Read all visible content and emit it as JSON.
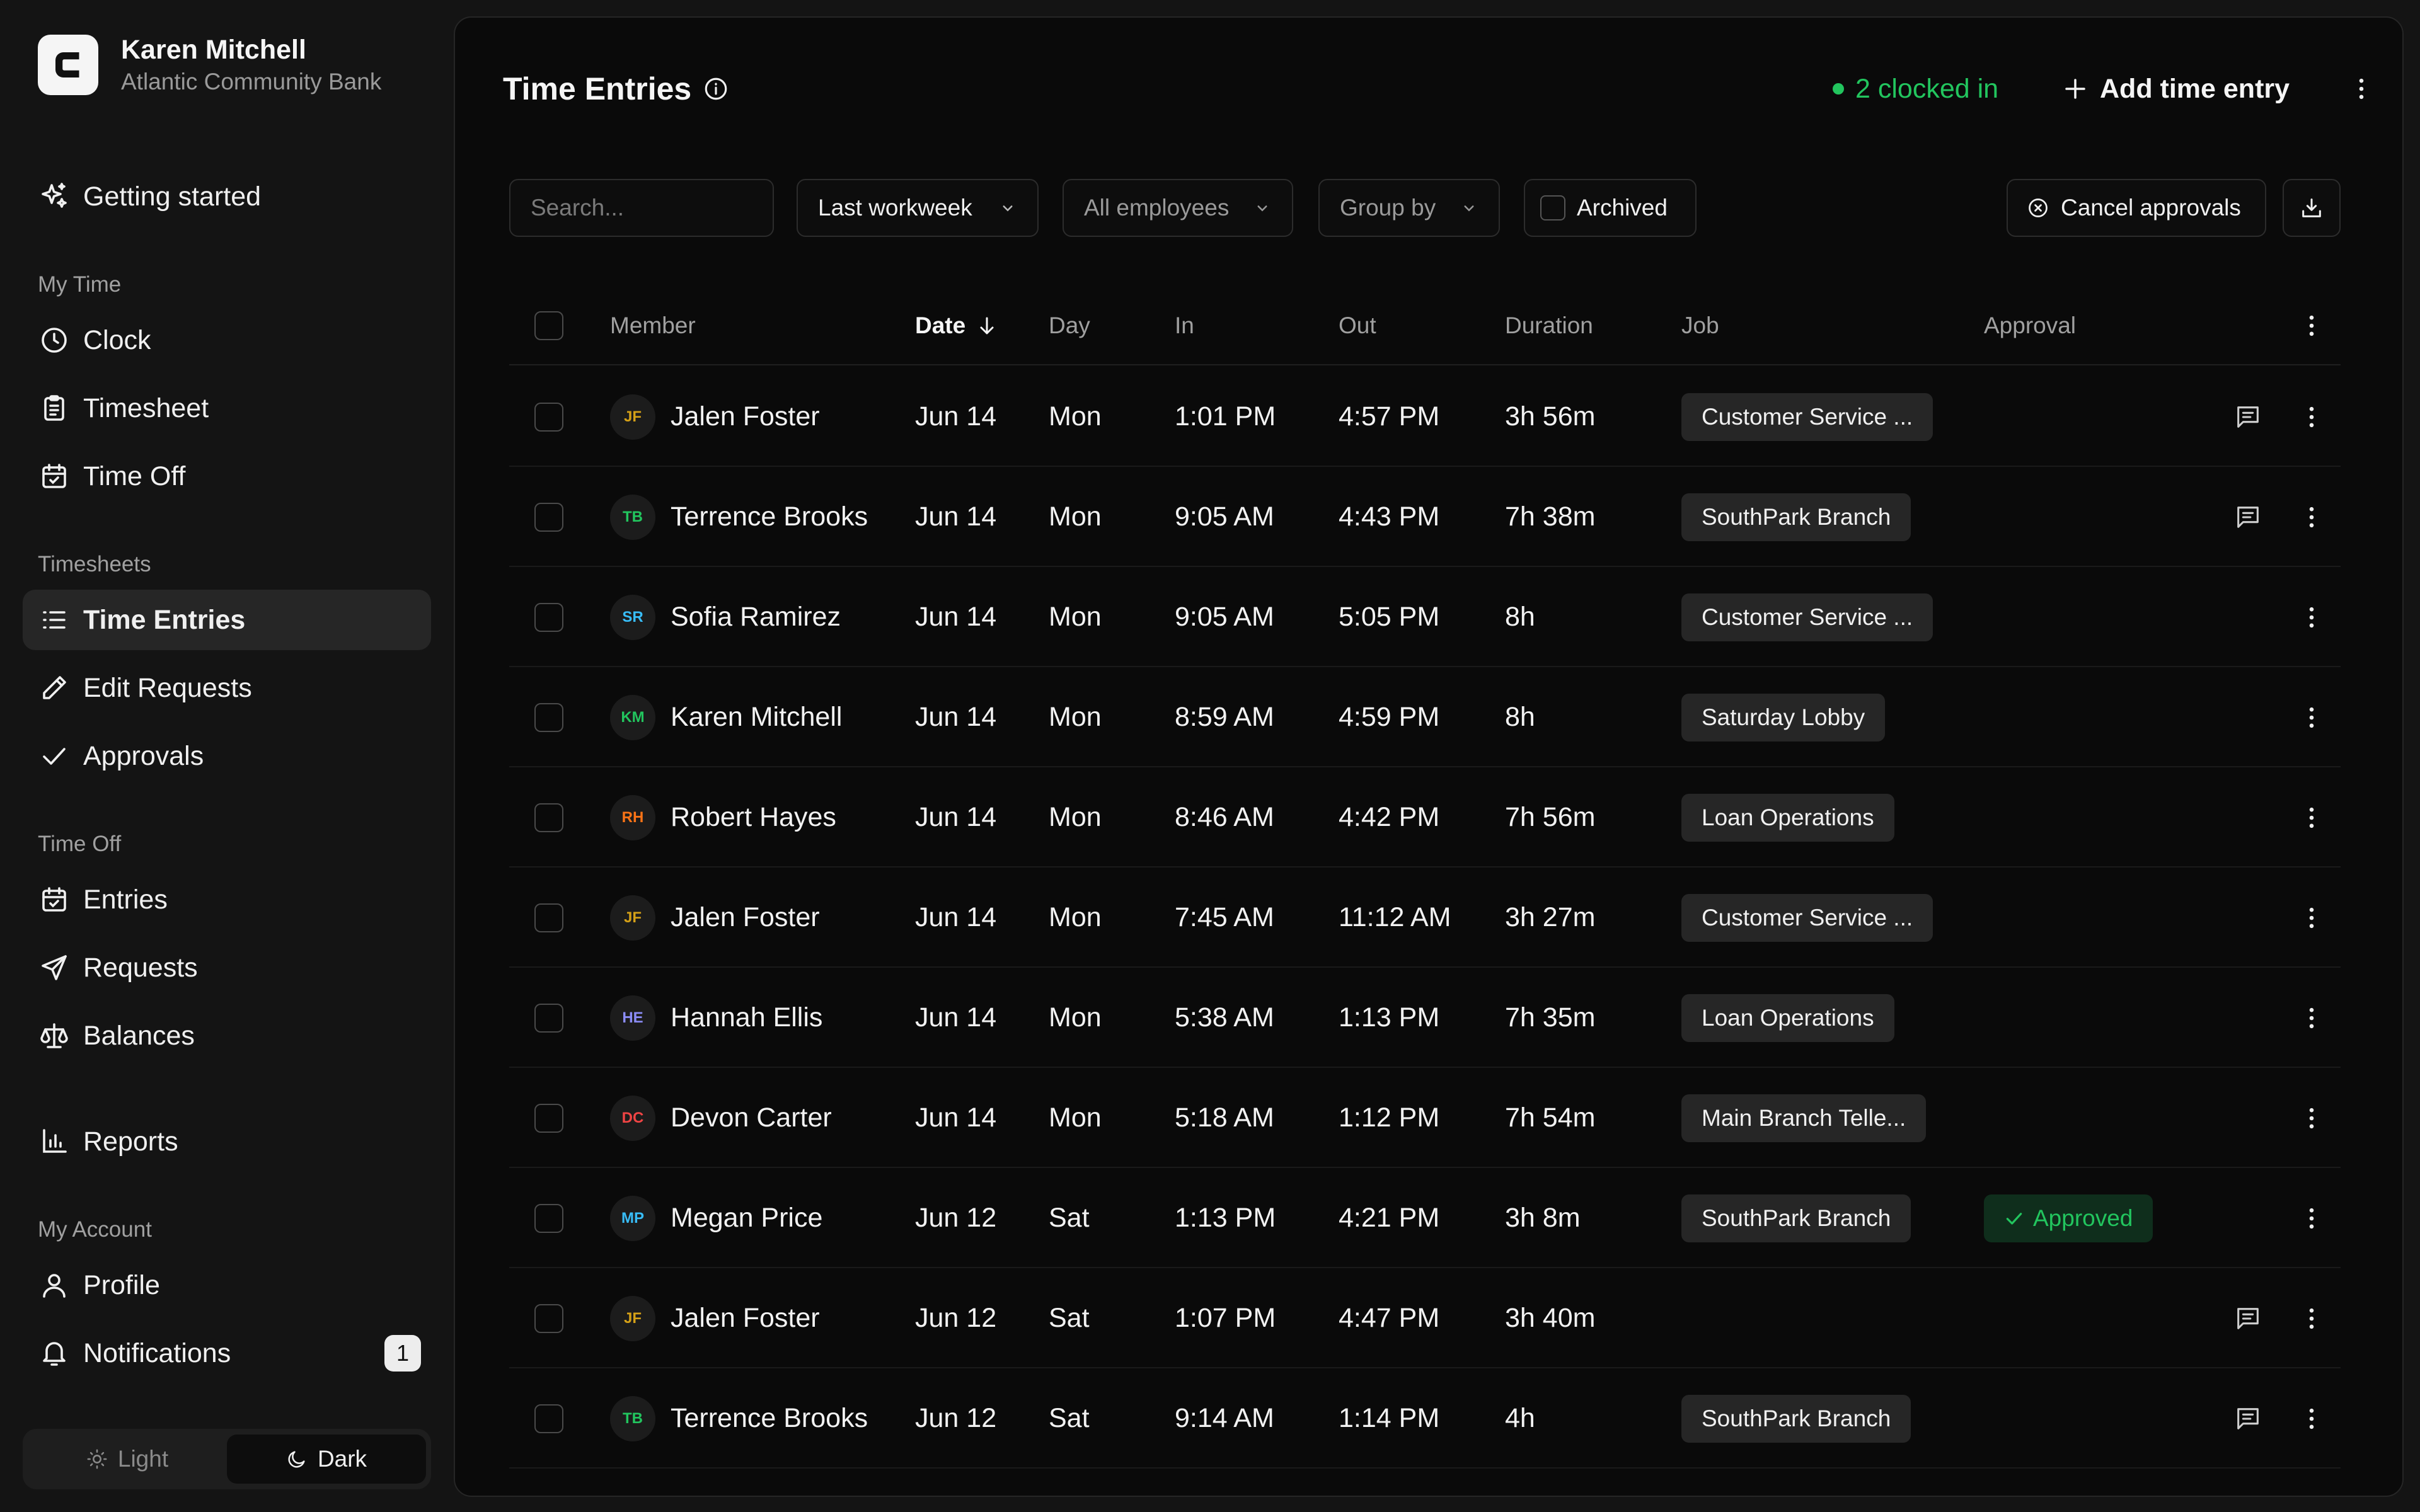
{
  "sidebar": {
    "user_name": "Karen Mitchell",
    "org_name": "Atlantic Community Bank",
    "getting_started": "Getting started",
    "sections": {
      "my_time": "My Time",
      "timesheets": "Timesheets",
      "time_off": "Time Off",
      "my_account": "My Account"
    },
    "items": {
      "clock": "Clock",
      "timesheet": "Timesheet",
      "time_off": "Time Off",
      "time_entries": "Time Entries",
      "edit_requests": "Edit Requests",
      "approvals": "Approvals",
      "entries": "Entries",
      "requests": "Requests",
      "balances": "Balances",
      "reports": "Reports",
      "profile": "Profile",
      "notifications": "Notifications"
    },
    "notifications_badge": "1",
    "theme": {
      "light": "Light",
      "dark": "Dark",
      "selected": "Dark"
    }
  },
  "header": {
    "title": "Time Entries",
    "clocked_in": "2 clocked in",
    "add_label": "Add time entry"
  },
  "filters": {
    "search_placeholder": "Search...",
    "period": "Last workweek",
    "employees": "All employees",
    "group_by": "Group by",
    "archived": "Archived",
    "cancel_approvals": "Cancel approvals"
  },
  "table": {
    "columns": {
      "member": "Member",
      "date": "Date",
      "day": "Day",
      "in": "In",
      "out": "Out",
      "duration": "Duration",
      "job": "Job",
      "approval": "Approval"
    },
    "rows": [
      {
        "initials": "JF",
        "color": "#d4a017",
        "member": "Jalen Foster",
        "date": "Jun 14",
        "day": "Mon",
        "in": "1:01 PM",
        "out": "4:57 PM",
        "duration": "3h 56m",
        "job": "Customer Service ...",
        "approval": "",
        "comment": true
      },
      {
        "initials": "TB",
        "color": "#22c55e",
        "member": "Terrence Brooks",
        "date": "Jun 14",
        "day": "Mon",
        "in": "9:05 AM",
        "out": "4:43 PM",
        "duration": "7h 38m",
        "job": "SouthPark Branch",
        "approval": "",
        "comment": true
      },
      {
        "initials": "SR",
        "color": "#38bdf8",
        "member": "Sofia Ramirez",
        "date": "Jun 14",
        "day": "Mon",
        "in": "9:05 AM",
        "out": "5:05 PM",
        "duration": "8h",
        "job": "Customer Service ...",
        "approval": "",
        "comment": false
      },
      {
        "initials": "KM",
        "color": "#22c55e",
        "member": "Karen Mitchell",
        "date": "Jun 14",
        "day": "Mon",
        "in": "8:59 AM",
        "out": "4:59 PM",
        "duration": "8h",
        "job": "Saturday Lobby",
        "approval": "",
        "comment": false
      },
      {
        "initials": "RH",
        "color": "#f97316",
        "member": "Robert Hayes",
        "date": "Jun 14",
        "day": "Mon",
        "in": "8:46 AM",
        "out": "4:42 PM",
        "duration": "7h 56m",
        "job": "Loan Operations",
        "approval": "",
        "comment": false
      },
      {
        "initials": "JF",
        "color": "#d4a017",
        "member": "Jalen Foster",
        "date": "Jun 14",
        "day": "Mon",
        "in": "7:45 AM",
        "out": "11:12 AM",
        "duration": "3h 27m",
        "job": "Customer Service ...",
        "approval": "",
        "comment": false
      },
      {
        "initials": "HE",
        "color": "#8b8cf6",
        "member": "Hannah Ellis",
        "date": "Jun 14",
        "day": "Mon",
        "in": "5:38 AM",
        "out": "1:13 PM",
        "duration": "7h 35m",
        "job": "Loan Operations",
        "approval": "",
        "comment": false
      },
      {
        "initials": "DC",
        "color": "#ef4444",
        "member": "Devon Carter",
        "date": "Jun 14",
        "day": "Mon",
        "in": "5:18 AM",
        "out": "1:12 PM",
        "duration": "7h 54m",
        "job": "Main Branch Telle...",
        "approval": "",
        "comment": false
      },
      {
        "initials": "MP",
        "color": "#38bdf8",
        "member": "Megan Price",
        "date": "Jun 12",
        "day": "Sat",
        "in": "1:13 PM",
        "out": "4:21 PM",
        "duration": "3h 8m",
        "job": "SouthPark Branch",
        "approval": "Approved",
        "comment": false
      },
      {
        "initials": "JF",
        "color": "#d4a017",
        "member": "Jalen Foster",
        "date": "Jun 12",
        "day": "Sat",
        "in": "1:07 PM",
        "out": "4:47 PM",
        "duration": "3h 40m",
        "job": "",
        "approval": "",
        "comment": true
      },
      {
        "initials": "TB",
        "color": "#22c55e",
        "member": "Terrence Brooks",
        "date": "Jun 12",
        "day": "Sat",
        "in": "9:14 AM",
        "out": "1:14 PM",
        "duration": "4h",
        "job": "SouthPark Branch",
        "approval": "",
        "comment": true
      }
    ]
  },
  "colors": {
    "accent_green": "#22c55e",
    "background": "#0a0a0a",
    "sidebar": "#141414"
  }
}
